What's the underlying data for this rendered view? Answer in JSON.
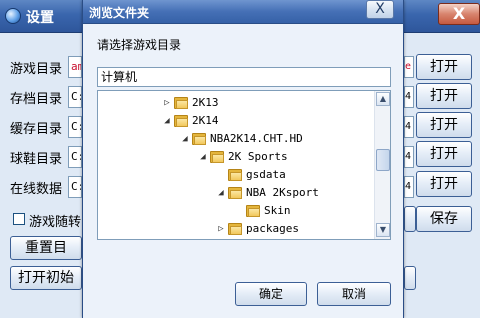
{
  "settings_window": {
    "title": "设置",
    "close_label": "X",
    "rows": [
      {
        "label": "游戏目录",
        "value": "am",
        "right_value": "e",
        "button": "打开"
      },
      {
        "label": "存档目录",
        "value": "C:",
        "right_value": "4",
        "button": "打开"
      },
      {
        "label": "缓存目录",
        "value": "C:",
        "right_value": "4",
        "button": "打开"
      },
      {
        "label": "球鞋目录",
        "value": "C:",
        "right_value": "4",
        "button": "打开"
      },
      {
        "label": "在线数据",
        "value": "C:",
        "right_value": "4",
        "button": "打开"
      }
    ],
    "follow_label": "游戏随转",
    "save_label": "保存",
    "reset_label": "重置目",
    "init_label": "打开初始"
  },
  "browse_dialog": {
    "title": "浏览文件夹",
    "close_label": "X",
    "prompt": "请选择游戏目录",
    "path_value": "计算机",
    "tree": [
      {
        "label": "2K13",
        "expander": "▷"
      },
      {
        "label": "2K14",
        "expander": "◢"
      },
      {
        "label": "NBA2K14.CHT.HD",
        "expander": "◢"
      },
      {
        "label": "2K Sports",
        "expander": "◢"
      },
      {
        "label": "gsdata",
        "expander": ""
      },
      {
        "label": "NBA 2Ksport",
        "expander": "◢"
      },
      {
        "label": "Skin",
        "expander": ""
      },
      {
        "label": "packages",
        "expander": "▷"
      }
    ],
    "ok_label": "确定",
    "cancel_label": "取消"
  }
}
